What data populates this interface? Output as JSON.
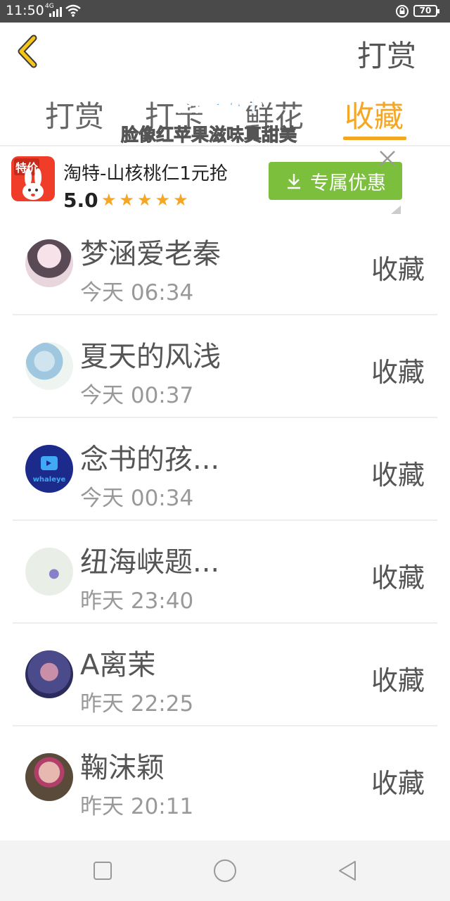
{
  "status_bar": {
    "time": "11:50",
    "network": "4G",
    "battery": "70"
  },
  "header": {
    "title": "打赏"
  },
  "tabs": [
    {
      "label": "打赏"
    },
    {
      "label": "打卡"
    },
    {
      "label": "鲜花"
    },
    {
      "label": "收藏",
      "active": true
    }
  ],
  "overlay": {
    "line1": "轻轻荡秋千",
    "line2": "脸像红苹果滋味真甜美"
  },
  "ad": {
    "icon_badge": "特价",
    "title": "淘特-山核桃仁1元抢",
    "rating": "5.0",
    "stars": "★★★★★",
    "button_label": "专属优惠"
  },
  "list": [
    {
      "name": "梦涵爱老秦",
      "time": "今天 06:34",
      "action": "收藏"
    },
    {
      "name": "夏天的风浅",
      "time": "今天 00:37",
      "action": "收藏"
    },
    {
      "name": "念书的孩...",
      "time": "今天 00:34",
      "action": "收藏",
      "avatar_text": "whaleye"
    },
    {
      "name": "纽海峡题...",
      "time": "昨天 23:40",
      "action": "收藏"
    },
    {
      "name": "A离茉",
      "time": "昨天 22:25",
      "action": "收藏"
    },
    {
      "name": "鞠沫颖",
      "time": "昨天 20:11",
      "action": "收藏"
    }
  ],
  "colors": {
    "accent": "#f5a623",
    "ad_button": "#7cbf3d",
    "status_bar": "#4a4a4a"
  },
  "icons": {
    "back": "chevron-left-icon",
    "nav_recent": "square-icon",
    "nav_home": "circle-icon",
    "nav_back": "triangle-icon"
  }
}
